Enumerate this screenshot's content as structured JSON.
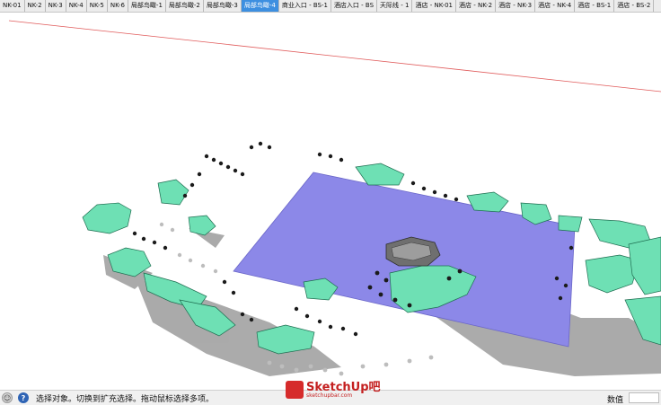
{
  "tabs": [
    {
      "label": "NK-01",
      "active": false
    },
    {
      "label": "NK-2",
      "active": false
    },
    {
      "label": "NK-3",
      "active": false
    },
    {
      "label": "NK-4",
      "active": false
    },
    {
      "label": "NK-5",
      "active": false
    },
    {
      "label": "NK-6",
      "active": false
    },
    {
      "label": "局部鸟瞰-1",
      "active": false
    },
    {
      "label": "局部鸟瞰-2",
      "active": false
    },
    {
      "label": "局部鸟瞰-3",
      "active": false
    },
    {
      "label": "局部鸟瞰-4",
      "active": true
    },
    {
      "label": "商业入口 - BS-1",
      "active": false
    },
    {
      "label": "酒店入口 - BS",
      "active": false
    },
    {
      "label": "天际线 - 1",
      "active": false
    },
    {
      "label": "酒店 - NK-01",
      "active": false
    },
    {
      "label": "酒店 - NK-2",
      "active": false
    },
    {
      "label": "酒店 - NK-3",
      "active": false
    },
    {
      "label": "酒店 - NK-4",
      "active": false
    },
    {
      "label": "酒店 - BS-1",
      "active": false
    },
    {
      "label": "酒店 - BS-2",
      "active": false
    }
  ],
  "status": {
    "message": "选择对象。切换到扩充选择。拖动鼠标选择多项。",
    "measurements_label": "数值",
    "measurements_value": ""
  },
  "watermark": {
    "brand": "SketchUp吧",
    "url": "sketchupbar.com"
  },
  "colors": {
    "active_tab": "#3d8fe0",
    "plane": "#8c88e8",
    "building": "#6ee0b4",
    "horizon_line": "#e05a5a"
  }
}
